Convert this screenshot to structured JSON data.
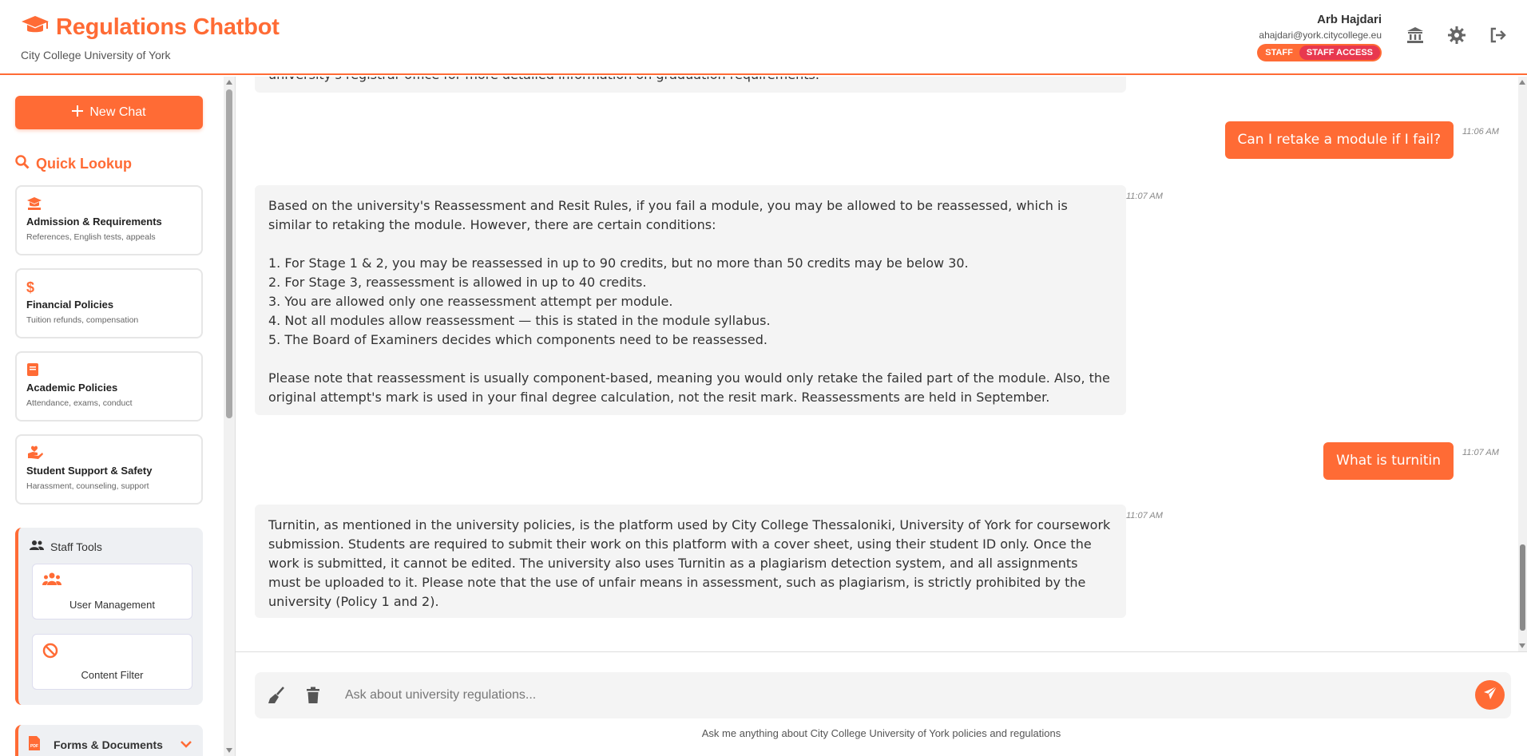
{
  "header": {
    "title": "Regulations Chatbot",
    "subtitle": "City College University of York",
    "user_name": "Arb Hajdari",
    "user_email": "ahajdari@york.citycollege.eu",
    "badge_role": "STAFF",
    "badge_access": "STAFF ACCESS",
    "icons": [
      "university-icon",
      "gear-icon",
      "logout-icon"
    ]
  },
  "sidebar": {
    "new_chat_label": "New Chat",
    "quick_lookup_title": "Quick Lookup",
    "quick_lookup": [
      {
        "icon": "graduation-cap-icon",
        "title": "Admission & Requirements",
        "desc": "References, English tests, appeals"
      },
      {
        "icon": "dollar-icon",
        "title": "Financial Policies",
        "desc": "Tuition refunds, compensation"
      },
      {
        "icon": "book-icon",
        "title": "Academic Policies",
        "desc": "Attendance, exams, conduct"
      },
      {
        "icon": "helping-hand-icon",
        "title": "Student Support & Safety",
        "desc": "Harassment, counseling, support"
      }
    ],
    "staff_tools_title": "Staff Tools",
    "staff_tools": [
      {
        "icon": "users-icon",
        "label": "User Management"
      },
      {
        "icon": "ban-icon",
        "label": "Content Filter"
      }
    ],
    "forms_docs_label": "Forms & Documents"
  },
  "chat": {
    "partial_top": "university's registrar office for more detailed information on graduation requirements.",
    "user_q1": "Can I retake a module if I fail?",
    "user_q1_time": "11:06 AM",
    "bot_a1_time": "11:07 AM",
    "bot_a1": {
      "intro": "Based on the university's Reassessment and Resit Rules, if you fail a module, you may be allowed to be reassessed, which is similar to retaking the module. However, there are certain conditions:",
      "items": [
        "1. For Stage 1 & 2, you may be reassessed in up to 90 credits, but no more than 50 credits may be below 30.",
        "2. For Stage 3, reassessment is allowed in up to 40 credits.",
        "3. You are allowed only one reassessment attempt per module.",
        "4. Not all modules allow reassessment — this is stated in the module syllabus.",
        "5. The Board of Examiners decides which components need to be reassessed."
      ],
      "outro": "Please note that reassessment is usually component-based, meaning you would only retake the failed part of the module. Also, the original attempt's mark is used in your final degree calculation, not the resit mark. Reassessments are held in September."
    },
    "user_q2": "What is turnitin",
    "user_q2_time": "11:07 AM",
    "bot_a2_time": "11:07 AM",
    "bot_a2": "Turnitin, as mentioned in the university policies, is the platform used by City College Thessaloniki, University of York for coursework submission. Students are required to submit their work on this platform with a cover sheet, using their student ID only. Once the work is submitted, it cannot be edited. The university also uses Turnitin as a plagiarism detection system, and all assignments must be uploaded to it. Please note that the use of unfair means in assessment, such as plagiarism, is strictly prohibited by the university (Policy 1 and 2)."
  },
  "input": {
    "placeholder": "Ask about university regulations...",
    "value": "",
    "hint": "Ask me anything about City College University of York policies and regulations"
  },
  "colors": {
    "accent": "#ff6b35",
    "badge_red": "#e8384f"
  }
}
